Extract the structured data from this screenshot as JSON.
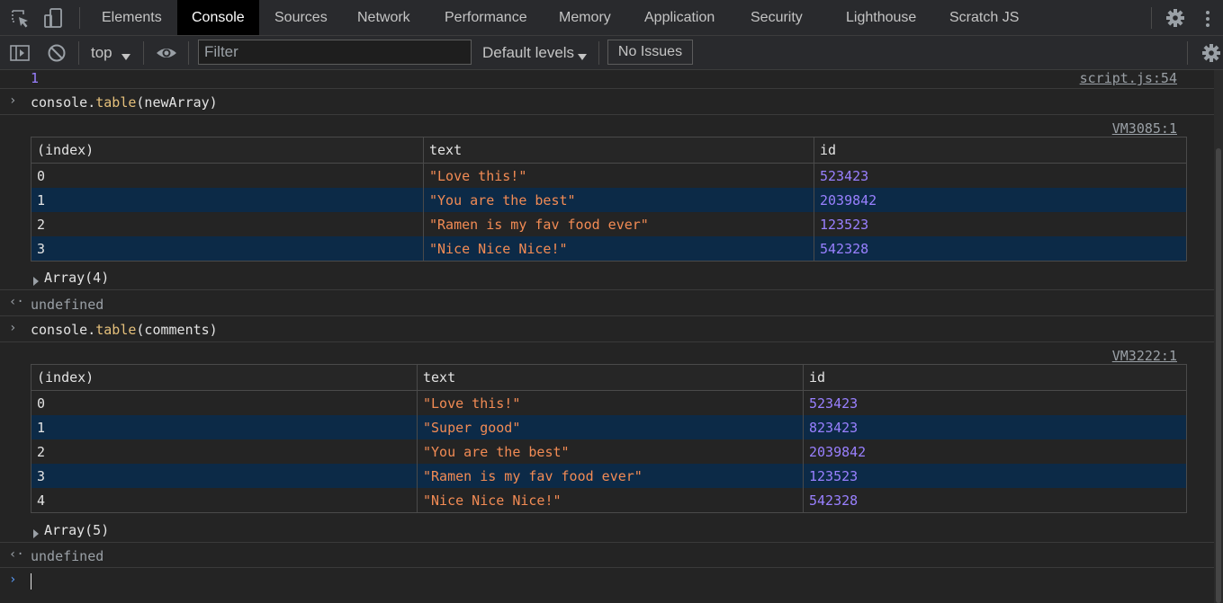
{
  "tabs": [
    "Elements",
    "Console",
    "Sources",
    "Network",
    "Performance",
    "Memory",
    "Application",
    "Security",
    "Lighthouse",
    "Scratch JS"
  ],
  "active_tab": "Console",
  "toolbar": {
    "context": "top",
    "filter_placeholder": "Filter",
    "levels": "Default levels",
    "issues": "No Issues"
  },
  "console": {
    "prev_value": "1",
    "prev_source": "script.js:54",
    "cmd1": {
      "obj": "console",
      "dot": ".",
      "method": "table",
      "args": "(newArray)"
    },
    "table1": {
      "source": "VM3085:1",
      "headers": [
        "(index)",
        "text",
        "id"
      ],
      "rows": [
        {
          "index": "0",
          "text": "\"Love this!\"",
          "id": "523423"
        },
        {
          "index": "1",
          "text": "\"You are the best\"",
          "id": "2039842"
        },
        {
          "index": "2",
          "text": "\"Ramen is my fav food ever\"",
          "id": "123523"
        },
        {
          "index": "3",
          "text": "\"Nice Nice Nice!\"",
          "id": "542328"
        }
      ],
      "summary": "Array(4)"
    },
    "result1": "undefined",
    "cmd2": {
      "obj": "console",
      "dot": ".",
      "method": "table",
      "args": "(comments)"
    },
    "table2": {
      "source": "VM3222:1",
      "headers": [
        "(index)",
        "text",
        "id"
      ],
      "rows": [
        {
          "index": "0",
          "text": "\"Love this!\"",
          "id": "523423"
        },
        {
          "index": "1",
          "text": "\"Super good\"",
          "id": "823423"
        },
        {
          "index": "2",
          "text": "\"You are the best\"",
          "id": "2039842"
        },
        {
          "index": "3",
          "text": "\"Ramen is my fav food ever\"",
          "id": "123523"
        },
        {
          "index": "4",
          "text": "\"Nice Nice Nice!\"",
          "id": "542328"
        }
      ],
      "summary": "Array(5)"
    },
    "result2": "undefined"
  },
  "colors": {
    "string": "#f28b54",
    "number": "#9980ff",
    "method": "#e5c07b",
    "row_highlight": "#0c2a47",
    "prompt": "#5a9cf8"
  }
}
